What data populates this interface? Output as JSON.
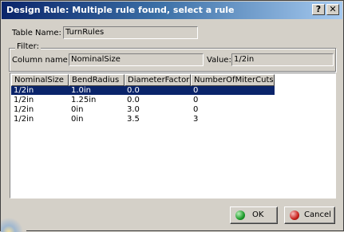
{
  "window": {
    "title": "Design Rule: Multiple rule found, select a rule",
    "help_label": "?",
    "close_label": "✕"
  },
  "table_name": {
    "label": "Table Name:",
    "value": "TurnRules"
  },
  "filter": {
    "group_label": "Filter:",
    "column_label": "Column name:",
    "column_value": "NominalSize",
    "value_label": "Value:",
    "value_value": "1/2in"
  },
  "grid": {
    "headers": [
      "NominalSize",
      "BendRadius",
      "DiameterFactor",
      "NumberOfMiterCuts"
    ],
    "rows": [
      [
        "1/2in",
        "1.0in",
        "0.0",
        "0"
      ],
      [
        "1/2in",
        "1.25in",
        "0.0",
        "0"
      ],
      [
        "1/2in",
        "0in",
        "3.0",
        "0"
      ],
      [
        "1/2in",
        "0in",
        "3.5",
        "3"
      ]
    ],
    "selected_row": 0
  },
  "buttons": {
    "ok": "OK",
    "cancel": "Cancel"
  },
  "colors": {
    "ok_icon": "#1c9a2a",
    "cancel_icon": "#c8201c",
    "selection": "#0a246a"
  }
}
